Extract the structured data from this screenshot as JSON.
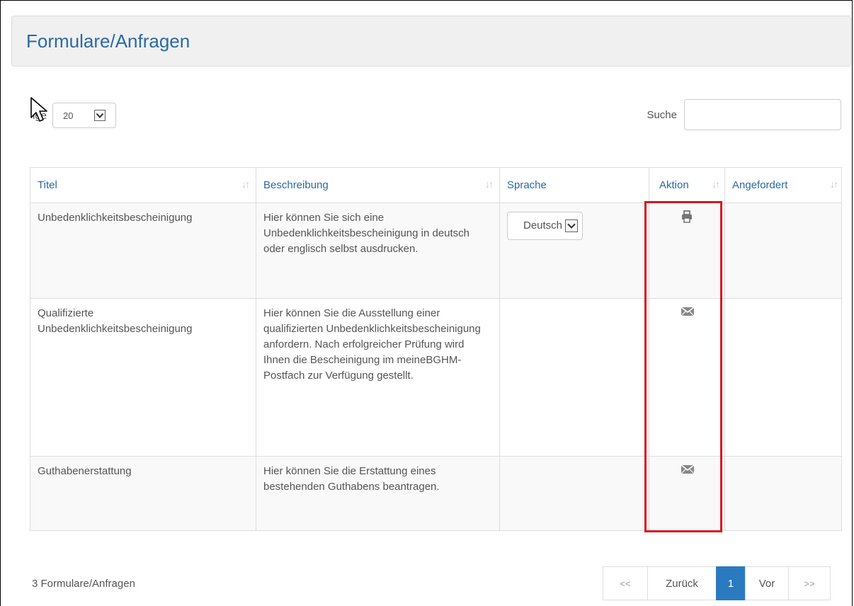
{
  "header": {
    "title": "Formulare/Anfragen"
  },
  "length": {
    "label": "Zeige",
    "label_visible": "ige",
    "value": "20"
  },
  "search": {
    "label": "Suche",
    "value": ""
  },
  "table": {
    "columns": [
      "Titel",
      "Beschreibung",
      "Sprache",
      "Aktion",
      "Angefordert"
    ],
    "rows": [
      {
        "titel": "Unbedenklichkeitsbescheinigung",
        "beschreibung": "Hier können Sie sich eine Unbedenklichkeitsbescheinigung in deutsch oder englisch selbst ausdrucken.",
        "sprache": "Deutsch",
        "aktion_icon": "printer-icon",
        "angefordert": ""
      },
      {
        "titel": "Qualifizierte Unbedenklichkeitsbescheinigung",
        "beschreibung": "Hier können Sie die Ausstellung einer qualifizierten Unbedenklichkeitsbescheinigung anfordern. Nach erfolgreicher Prüfung wird Ihnen die Bescheinigung im meineBGHM-Postfach zur Verfügung gestellt.",
        "sprache": "",
        "aktion_icon": "envelope-icon",
        "angefordert": ""
      },
      {
        "titel": "Guthabenerstattung",
        "beschreibung": "Hier können Sie die Erstattung eines bestehenden Guthabens beantragen.",
        "sprache": "",
        "aktion_icon": "envelope-icon",
        "angefordert": ""
      }
    ]
  },
  "footer": {
    "info": "3 Formulare/Anfragen"
  },
  "pager": {
    "first": "<<",
    "prev": "Zurück",
    "current": "1",
    "next": "Vor",
    "last": ">>"
  },
  "colors": {
    "accent": "#2a6aa5",
    "highlight": "#d7161e",
    "active_page": "#2a7ac0"
  }
}
